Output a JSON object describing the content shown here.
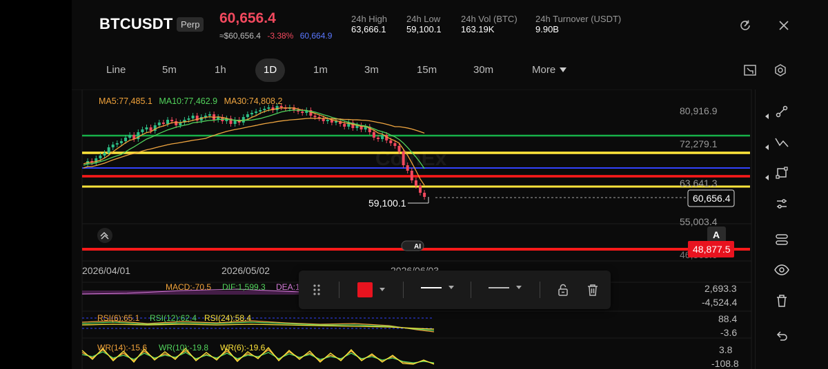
{
  "header": {
    "symbol": "BTCUSDT",
    "contract_badge": "Perp",
    "last_price": "60,656.4",
    "approx_price": "≈$60,656.4",
    "change_pct": "-3.38%",
    "mark_price": "60,664.9",
    "stats": [
      {
        "label": "24h  High",
        "value": "63,666.1"
      },
      {
        "label": "24h  Low",
        "value": "59,100.1"
      },
      {
        "label": "24h  Vol (BTC)",
        "value": "163.19K"
      },
      {
        "label": "24h  Turnover (USDT)",
        "value": "9.90B"
      }
    ],
    "refresh_icon": "refresh-icon",
    "close_icon": "close-icon"
  },
  "timeframes": {
    "items": [
      "Line",
      "5m",
      "1h",
      "1D",
      "1m",
      "3m",
      "15m",
      "30m"
    ],
    "active": "1D",
    "more_label": "More",
    "icons": [
      "chart-switch-icon",
      "settings-icon"
    ]
  },
  "chart": {
    "ma_legend": [
      {
        "label": "MA5:77,485.1",
        "color": "#f2a33a"
      },
      {
        "label": "MA10:77,462.9",
        "color": "#52d45c"
      },
      {
        "label": "MA30:74,808.2",
        "color": "#f0a640"
      }
    ],
    "price_axis": [
      "80,916.9",
      "72,279.1",
      "63,641.3",
      "55,003.4"
    ],
    "date_axis": [
      "2026/04/01",
      "2026/05/02",
      "2026/06/03"
    ],
    "last_price_tag": "60,656.4",
    "low_marker": "59,100.1",
    "line_tag": "48,877.5",
    "cutoff_label": "46,365.6",
    "watermark": "CoinEx",
    "ai_badge": "AI",
    "a_label": "A",
    "colors": {
      "up": "#2ebd85",
      "down": "#f2495e",
      "green_line": "#17b24a",
      "yellow_line": "#ffe53b",
      "blue_line": "#3243ff",
      "red_line": "#ff1a1a"
    }
  },
  "indicators": {
    "macd": {
      "labels": [
        "MACD:-70.5",
        "DIF:1,599.3",
        "DEA:1"
      ],
      "axis": [
        "2,693.3",
        "-4,524.4"
      ]
    },
    "rsi": {
      "labels": [
        "RSI(6):65.1",
        "RSI(12):62.4",
        "RSI(24):58.4"
      ],
      "axis": [
        "88.4",
        "-3.6"
      ]
    },
    "wr": {
      "labels": [
        "WR(14):-15.6",
        "WR(10):-19.8",
        "WR(6):-19.6"
      ],
      "axis": [
        "3.8",
        "-108.8"
      ]
    }
  },
  "drawing_toolbar": {
    "color": "#e8131f",
    "icons": [
      "drag-handle-icon",
      "color-swatch",
      "line-width-icon",
      "line-style-icon",
      "lock-icon",
      "trash-icon"
    ]
  },
  "side_tools": [
    "node-line-icon",
    "trend-line-icon",
    "shape-icon",
    "adjust-icon",
    "indicator-icon",
    "eye-icon",
    "delete-icon",
    "undo-icon"
  ]
}
